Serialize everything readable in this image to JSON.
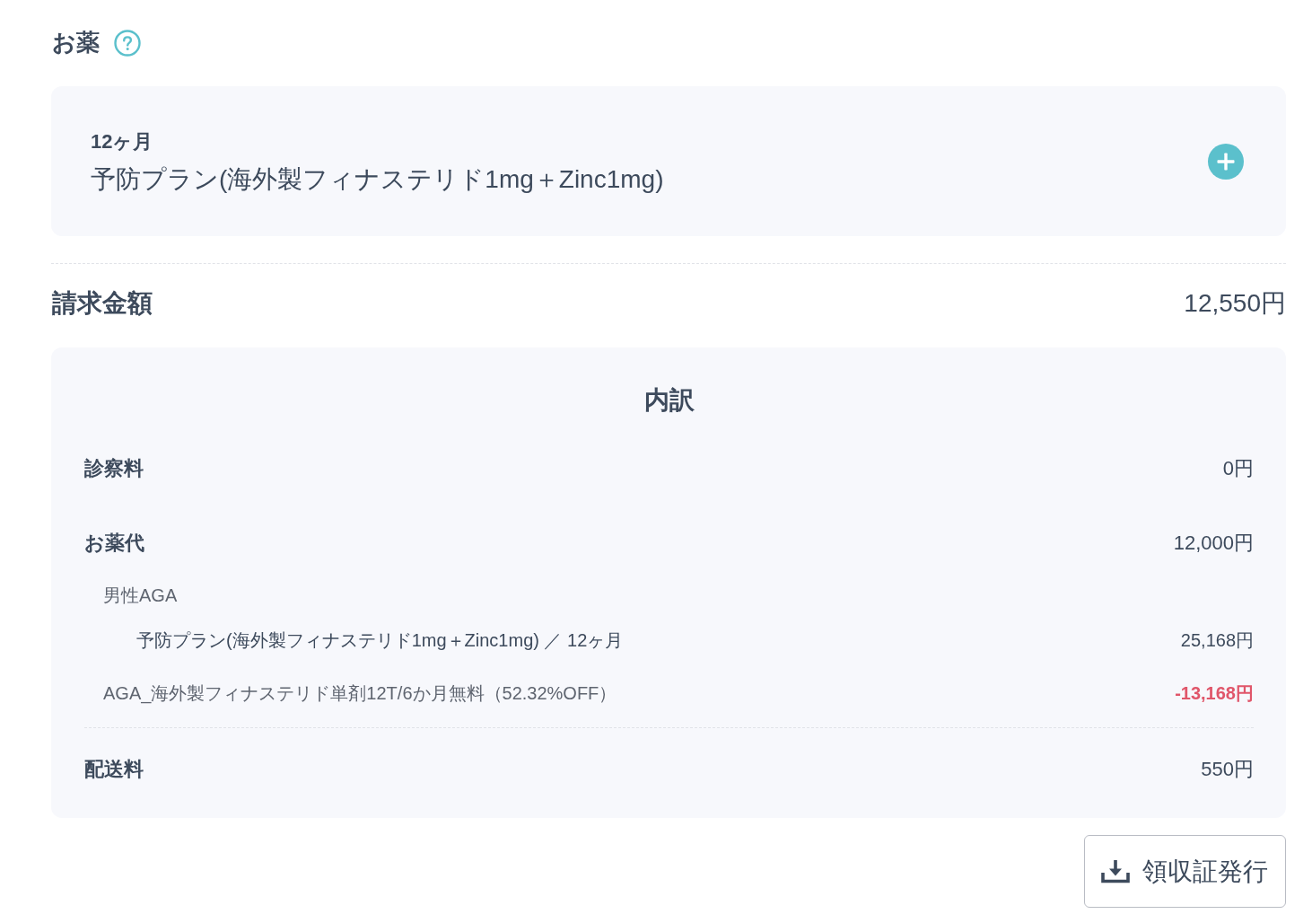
{
  "section": {
    "title": "お薬"
  },
  "plan_card": {
    "duration": "12ヶ月",
    "plan_name": "予防プラン(海外製フィナステリド1mg＋Zinc1mg)"
  },
  "billing": {
    "label": "請求金額",
    "amount": "12,550円"
  },
  "breakdown": {
    "title": "内訳",
    "rows": [
      {
        "kind": "fee",
        "label": "診察料",
        "amount": "0円"
      },
      {
        "kind": "fee",
        "label": "お薬代",
        "amount": "12,000円"
      },
      {
        "kind": "category",
        "label": "男性AGA"
      },
      {
        "kind": "item",
        "label": "予防プラン(海外製フィナステリド1mg＋Zinc1mg) ／ 12ヶ月",
        "amount": "25,168円"
      },
      {
        "kind": "discount",
        "label": "AGA_海外製フィナステリド単剤12T/6か月無料（52.32%OFF）",
        "amount": "-13,168円"
      }
    ],
    "footer_rows": [
      {
        "kind": "fee",
        "label": "配送料",
        "amount": "550円"
      }
    ]
  },
  "receipt_button": {
    "label": "領収証発行"
  }
}
